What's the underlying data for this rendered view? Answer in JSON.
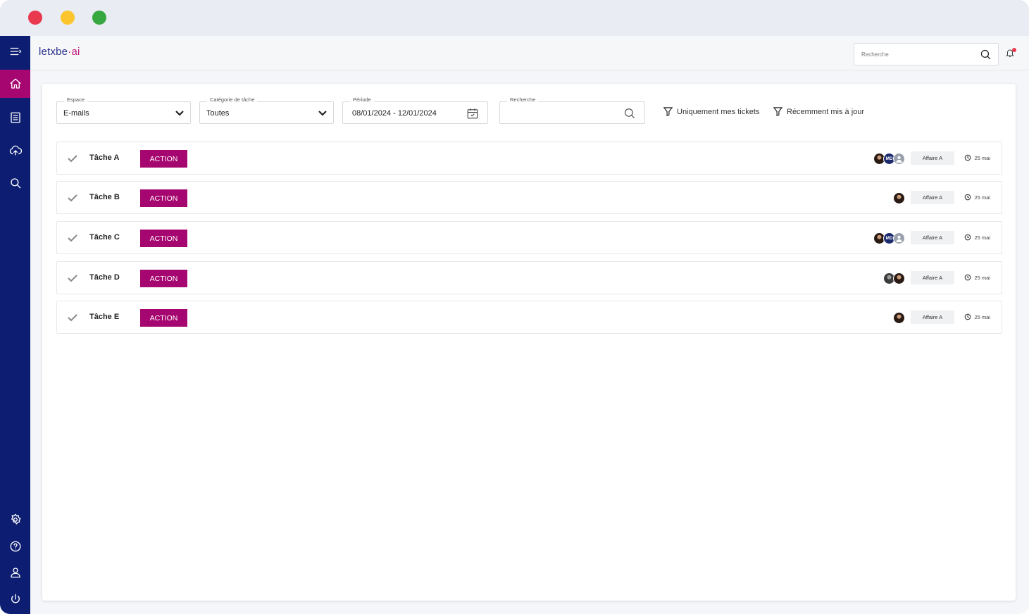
{
  "app": {
    "logo_main": "letxbe",
    "logo_sep": "·",
    "logo_ai": "ai"
  },
  "topbar": {
    "search_placeholder": "Recherche"
  },
  "sidebar": {
    "items": [
      {
        "icon": "menu-icon"
      },
      {
        "icon": "home-icon",
        "active": true
      },
      {
        "icon": "list-icon"
      },
      {
        "icon": "cloud-upload-icon"
      },
      {
        "icon": "search-icon"
      }
    ],
    "bottom_items": [
      {
        "icon": "gear-icon"
      },
      {
        "icon": "help-icon"
      },
      {
        "icon": "user-icon"
      },
      {
        "icon": "power-icon"
      }
    ]
  },
  "filters": {
    "espace": {
      "label": "Espace",
      "value": "E-mails"
    },
    "categorie": {
      "label": "Catégorie de tâche",
      "value": "Toutes"
    },
    "periode": {
      "label": "Période",
      "value": "08/01/2024 - 12/01/2024"
    },
    "recherche": {
      "label": "Recherche",
      "value": ""
    },
    "only_mine": "Uniquement mes tickets",
    "recent": "Récemment mis à jour"
  },
  "tasks": [
    {
      "name": "Tâche A",
      "action": "ACTION",
      "avatars": [
        "photo1",
        "MD",
        "default"
      ],
      "tag": "Affaire A",
      "date": "25 mai"
    },
    {
      "name": "Tâche B",
      "action": "ACTION",
      "avatars": [
        "photo1"
      ],
      "tag": "Affaire A",
      "date": "25 mai"
    },
    {
      "name": "Tâche C",
      "action": "ACTION",
      "avatars": [
        "photo1",
        "MD",
        "default"
      ],
      "tag": "Affaire A",
      "date": "25 mai"
    },
    {
      "name": "Tâche D",
      "action": "ACTION",
      "avatars": [
        "photo2",
        "photo1"
      ],
      "tag": "Affaire A",
      "date": "25 mai"
    },
    {
      "name": "Tâche E",
      "action": "ACTION",
      "avatars": [
        "photo1"
      ],
      "tag": "Affaire A",
      "date": "25 mai"
    }
  ],
  "colors": {
    "sidebar": "#0d1e72",
    "accent": "#a6066f"
  }
}
